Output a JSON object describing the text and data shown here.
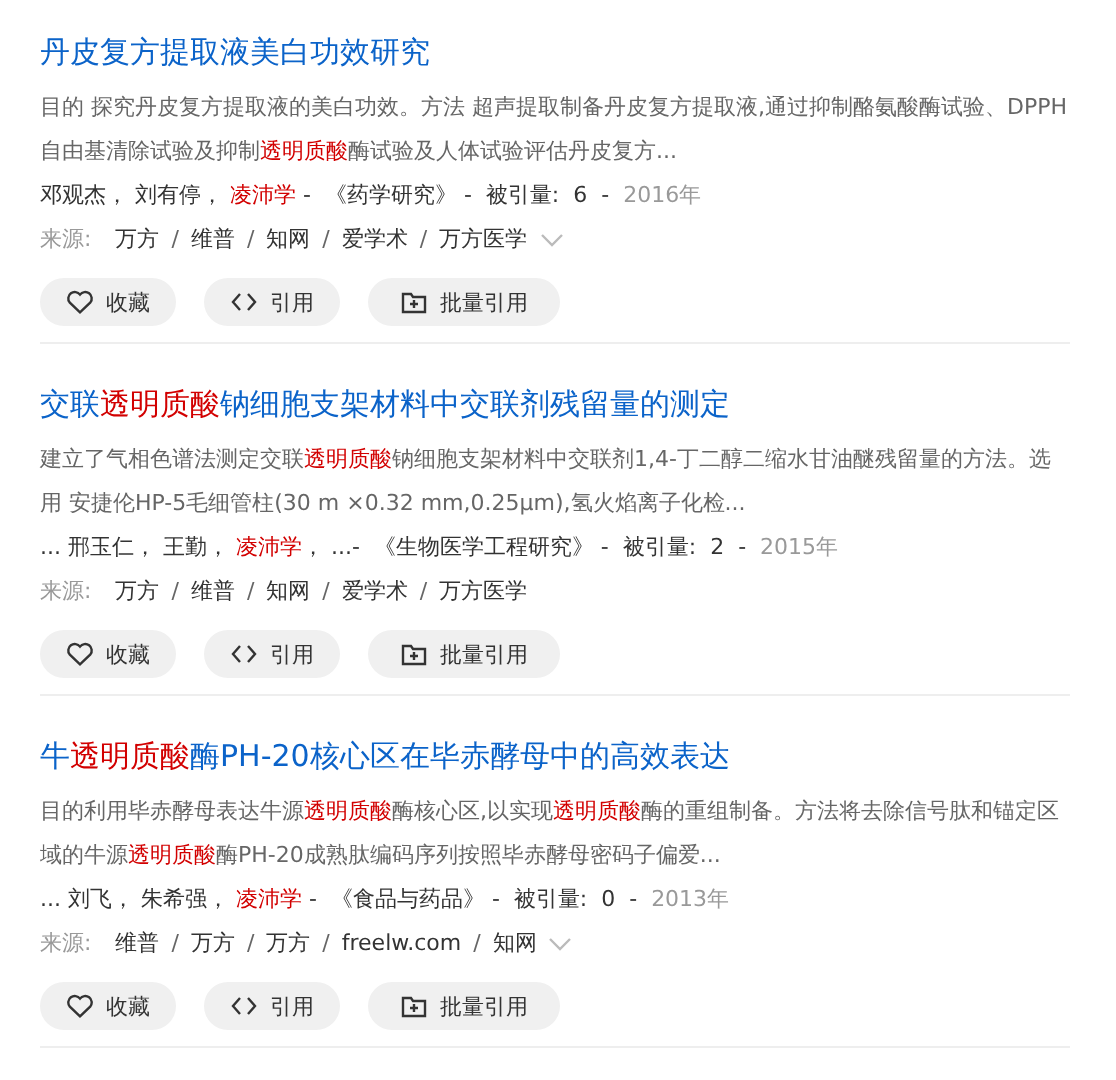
{
  "results": [
    {
      "title": [
        {
          "text": "丹皮复方提取液美白功效研究",
          "highlight": false
        }
      ],
      "abstract": [
        {
          "text": "目的 探究丹皮复方提取液的美白功效。方法 超声提取制备丹皮复方提取液,通过抑制酪氨酸酶试验、DPPH自由基清除试验及抑制",
          "highlight": false
        },
        {
          "text": "透明质酸",
          "highlight": true
        },
        {
          "text": "酶试验及人体试验评估丹皮复方...",
          "highlight": false
        }
      ],
      "meta": [
        {
          "text": "邓观杰， 刘有停， ",
          "highlight": false
        },
        {
          "text": "凌沛学",
          "highlight": true
        },
        {
          "text": " -  《药学研究》 -  被引量:  6  -  ",
          "highlight": false
        }
      ],
      "year": "2016年",
      "source_label": "来源:",
      "sources": [
        "万方",
        "维普",
        "知网",
        "爱学术",
        "万方医学"
      ],
      "separator": "/",
      "more": true,
      "actions": [
        {
          "kind": "favorite",
          "label": "收藏"
        },
        {
          "kind": "cite",
          "label": "引用"
        },
        {
          "kind": "batch",
          "label": "批量引用"
        }
      ]
    },
    {
      "title": [
        {
          "text": "交联",
          "highlight": false
        },
        {
          "text": "透明质酸",
          "highlight": true
        },
        {
          "text": "钠细胞支架材料中交联剂残留量的测定",
          "highlight": false
        }
      ],
      "abstract": [
        {
          "text": "建立了气相色谱法测定交联",
          "highlight": false
        },
        {
          "text": "透明质酸",
          "highlight": true
        },
        {
          "text": "钠细胞支架材料中交联剂1,4-丁二醇二缩水甘油醚残留量的方法。选用 安捷伦HP-5毛细管柱(30 m ×0.32 mm,0.25μm),氢火焰离子化检...",
          "highlight": false
        }
      ],
      "meta": [
        {
          "text": "... 邢玉仁， 王勤， ",
          "highlight": false
        },
        {
          "text": "凌沛学",
          "highlight": true
        },
        {
          "text": "， ...-  《生物医学工程研究》 -  被引量:  2  -  ",
          "highlight": false
        }
      ],
      "year": "2015年",
      "source_label": "来源:",
      "sources": [
        "万方",
        "维普",
        "知网",
        "爱学术",
        "万方医学"
      ],
      "separator": "/",
      "more": false,
      "actions": [
        {
          "kind": "favorite",
          "label": "收藏"
        },
        {
          "kind": "cite",
          "label": "引用"
        },
        {
          "kind": "batch",
          "label": "批量引用"
        }
      ]
    },
    {
      "title": [
        {
          "text": "牛",
          "highlight": false
        },
        {
          "text": "透明质酸",
          "highlight": true
        },
        {
          "text": "酶PH-20核心区在毕赤酵母中的高效表达",
          "highlight": false
        }
      ],
      "abstract": [
        {
          "text": "目的利用毕赤酵母表达牛源",
          "highlight": false
        },
        {
          "text": "透明质酸",
          "highlight": true
        },
        {
          "text": "酶核心区,以实现",
          "highlight": false
        },
        {
          "text": "透明质酸",
          "highlight": true
        },
        {
          "text": "酶的重组制备。方法将去除信号肽和锚定区域的牛源",
          "highlight": false
        },
        {
          "text": "透明质酸",
          "highlight": true
        },
        {
          "text": "酶PH-20成熟肽编码序列按照毕赤酵母密码子偏爱...",
          "highlight": false
        }
      ],
      "meta": [
        {
          "text": "... 刘飞， 朱希强， ",
          "highlight": false
        },
        {
          "text": "凌沛学",
          "highlight": true
        },
        {
          "text": " -  《食品与药品》 -  被引量:  0  -  ",
          "highlight": false
        }
      ],
      "year": "2013年",
      "source_label": "来源:",
      "sources": [
        "维普",
        "万方",
        "万方",
        "freelw.com",
        "知网"
      ],
      "separator": "/",
      "more": true,
      "actions": [
        {
          "kind": "favorite",
          "label": "收藏"
        },
        {
          "kind": "cite",
          "label": "引用"
        },
        {
          "kind": "batch",
          "label": "批量引用"
        }
      ]
    }
  ]
}
